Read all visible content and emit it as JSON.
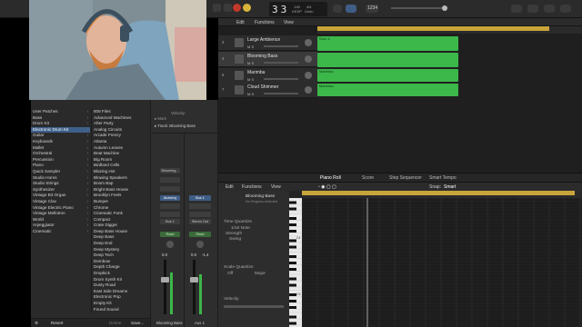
{
  "transport": {
    "bar": "3",
    "beat": "3",
    "tempo": "140",
    "tempo_label": "KEEP",
    "time_sig": "4/4",
    "key": "Gmin",
    "count_in": "1234",
    "zoom": "1"
  },
  "tracks_toolbar": {
    "edit": "Edit",
    "functions": "Functions",
    "view": "View"
  },
  "tracks": [
    {
      "num": "3",
      "name": "Large Ambience",
      "mute": "M",
      "solo": "S"
    },
    {
      "num": "4",
      "name": "Blooming Bass",
      "mute": "M",
      "solo": "S",
      "record": "R",
      "input": "I"
    },
    {
      "num": "6",
      "name": "Marimba",
      "mute": "M",
      "solo": "S"
    },
    {
      "num": "7",
      "name": "Cloud Shimmer",
      "mute": "M",
      "solo": "S"
    }
  ],
  "regions": [
    {
      "label": "Sum 4"
    },
    {
      "label": ""
    },
    {
      "label": "Marimba"
    },
    {
      "label": "Marimba"
    }
  ],
  "library": {
    "categories": [
      {
        "label": "User Patches",
        "has_children": true,
        "selected": false
      },
      {
        "label": "Bass",
        "has_children": true,
        "selected": false
      },
      {
        "label": "Drum Kit",
        "has_children": true,
        "selected": false
      },
      {
        "label": "Electronic Drum Kit",
        "has_children": true,
        "selected": true
      },
      {
        "label": "Guitar",
        "has_children": true,
        "selected": false
      },
      {
        "label": "Keyboards",
        "has_children": true,
        "selected": false
      },
      {
        "label": "Mallet",
        "has_children": true,
        "selected": false
      },
      {
        "label": "Orchestral",
        "has_children": true,
        "selected": false
      },
      {
        "label": "Percussion",
        "has_children": true,
        "selected": false
      },
      {
        "label": "Piano",
        "has_children": true,
        "selected": false
      },
      {
        "label": "Quick Sampler",
        "has_children": true,
        "selected": false
      },
      {
        "label": "Studio Horns",
        "has_children": true,
        "selected": false
      },
      {
        "label": "Studio Strings",
        "has_children": true,
        "selected": false
      },
      {
        "label": "Synthesizer",
        "has_children": true,
        "selected": false
      },
      {
        "label": "Vintage B3 Organ",
        "has_children": true,
        "selected": false
      },
      {
        "label": "Vintage Clav",
        "has_children": true,
        "selected": false
      },
      {
        "label": "Vintage Electric Piano",
        "has_children": true,
        "selected": false
      },
      {
        "label": "Vintage Mellotron",
        "has_children": true,
        "selected": false
      },
      {
        "label": "World",
        "has_children": true,
        "selected": false
      },
      {
        "label": "Arpeggiator",
        "has_children": true,
        "selected": false
      },
      {
        "label": "Cinematic",
        "has_children": true,
        "selected": false
      }
    ],
    "patches": [
      "808 Files",
      "Advanced Machines",
      "After Party",
      "Analog Circuits",
      "Arcade Frenzy",
      "Atlanta",
      "Autumn Leaves",
      "Beat Machine",
      "Big Room",
      "Birdland Cells",
      "Blazing Hot",
      "Blowing Speakers",
      "Boom Bap",
      "Bright Bass House",
      "Brooklyn Feels",
      "Bumper",
      "Chrome",
      "Cinematic Funk",
      "Compact",
      "Crate Digger",
      "Deep Bass House",
      "Deep Bass",
      "Deep End",
      "Deep Mystery",
      "Deep Tech",
      "Dembow",
      "Depth Charge",
      "Dropkick",
      "Drum Synth Kit",
      "Dusty Road",
      "East Side Dreams",
      "Electronic Pop",
      "Empty Kit",
      "Found Sound"
    ],
    "revert": "Revert",
    "delete": "Delete",
    "save": "Save..."
  },
  "inspector": {
    "region_header": "Velocity:",
    "more": "More",
    "track_label": "Track:",
    "track_name": "Blooming Bass",
    "channel_name": "Blooming...",
    "plugin_1": "Alchemy",
    "plugin_2": "Bus 1",
    "bus_1": "Bus 1",
    "stereo_out": "Stereo Out",
    "read": "Read",
    "meter_left": "0.0",
    "meter_right": "-1.4",
    "meter_right_2": "0.0",
    "strip_1_name": "Blooming Bass",
    "strip_2_name": "Aux 1"
  },
  "piano_roll": {
    "tabs": [
      "Piano Roll",
      "Score",
      "Step Sequencer",
      "Smart Tempo"
    ],
    "edit": "Edit",
    "functions": "Functions",
    "view": "View",
    "snap_label": "Snap:",
    "snap_value": "Smart",
    "region_name": "Blooming Bass",
    "region_sub": "No Regions selected",
    "time_quantize": "Time Quantize",
    "time_quantize_value": "1/16 Note",
    "strength_label": "Strength",
    "swing_label": "Swing",
    "scale_quantize": "Scale Quantize",
    "scale_off": "Off",
    "scale_major": "Major",
    "velocity": "Velocity",
    "c4": "C4",
    "c3": "C3"
  },
  "colors": {
    "region_green": "#3cb74a",
    "cycle_yellow": "#c9a43a",
    "selection_blue": "#3e5f8a"
  }
}
